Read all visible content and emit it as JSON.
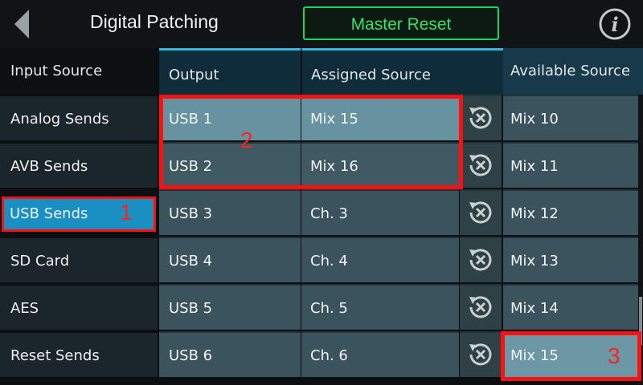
{
  "header": {
    "title": "Digital Patching",
    "master_reset": "Master Reset",
    "back_icon": "back-arrow-icon",
    "info_icon": "info-icon"
  },
  "left": {
    "header": "Input Source",
    "items": [
      "Analog Sends",
      "AVB Sends",
      "USB Sends",
      "SD Card",
      "AES",
      "Reset Sends"
    ],
    "selected_index": 2
  },
  "table": {
    "headers": {
      "output": "Output",
      "assigned": "Assigned Source"
    },
    "rows": [
      {
        "output": "USB 1",
        "assigned": "Mix 15"
      },
      {
        "output": "USB 2",
        "assigned": "Mix 16"
      },
      {
        "output": "USB 3",
        "assigned": "Ch. 3"
      },
      {
        "output": "USB 4",
        "assigned": "Ch. 4"
      },
      {
        "output": "USB 5",
        "assigned": "Ch. 5"
      },
      {
        "output": "USB 6",
        "assigned": "Ch. 6"
      }
    ],
    "reset_icon": "reset-x-icon"
  },
  "right": {
    "header": "Available Source",
    "items": [
      "Mix 10",
      "Mix 11",
      "Mix 12",
      "Mix 13",
      "Mix 14",
      "Mix 15"
    ],
    "highlighted_index": 5
  },
  "annotations": {
    "one": "1",
    "two": "2",
    "three": "3"
  },
  "colors": {
    "accent_green": "#2ee46c",
    "selected_blue": "#1a8fc2",
    "annotation_red": "#ff1010"
  }
}
